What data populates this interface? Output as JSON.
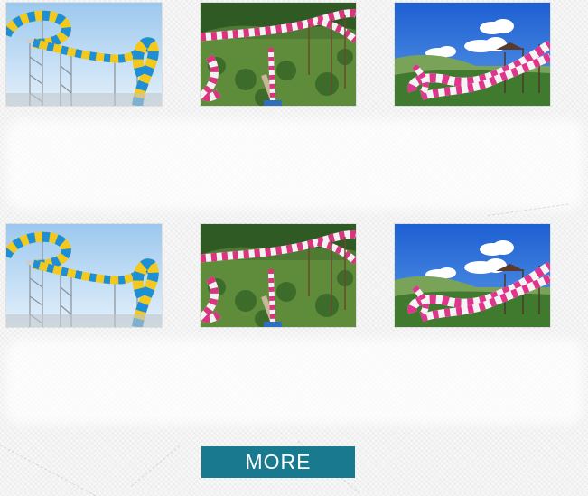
{
  "products": [
    {
      "scene": "blue-yellow-tube-slide"
    },
    {
      "scene": "pink-white-hillside-slide"
    },
    {
      "scene": "pink-white-sky-slide"
    },
    {
      "scene": "blue-yellow-tube-slide"
    },
    {
      "scene": "pink-white-hillside-slide"
    },
    {
      "scene": "pink-white-sky-slide"
    }
  ],
  "more_button": {
    "label": "MORE",
    "color": "#18798f"
  }
}
